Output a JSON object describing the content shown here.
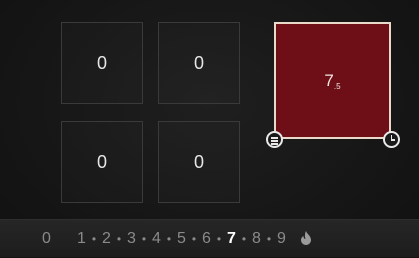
{
  "zones": [
    {
      "value": "0"
    },
    {
      "value": "0"
    },
    {
      "value": "0"
    },
    {
      "value": "0"
    }
  ],
  "large_zone": {
    "level": "7",
    "sub": ".5",
    "color": "#6e0f18"
  },
  "power_bar": {
    "levels": [
      "0",
      "1",
      "2",
      "3",
      "4",
      "5",
      "6",
      "7",
      "8",
      "9"
    ],
    "separator": "•",
    "selected": "7"
  },
  "icons": {
    "menu": "menu-icon",
    "timer": "timer-icon",
    "boost": "flame-icon"
  }
}
